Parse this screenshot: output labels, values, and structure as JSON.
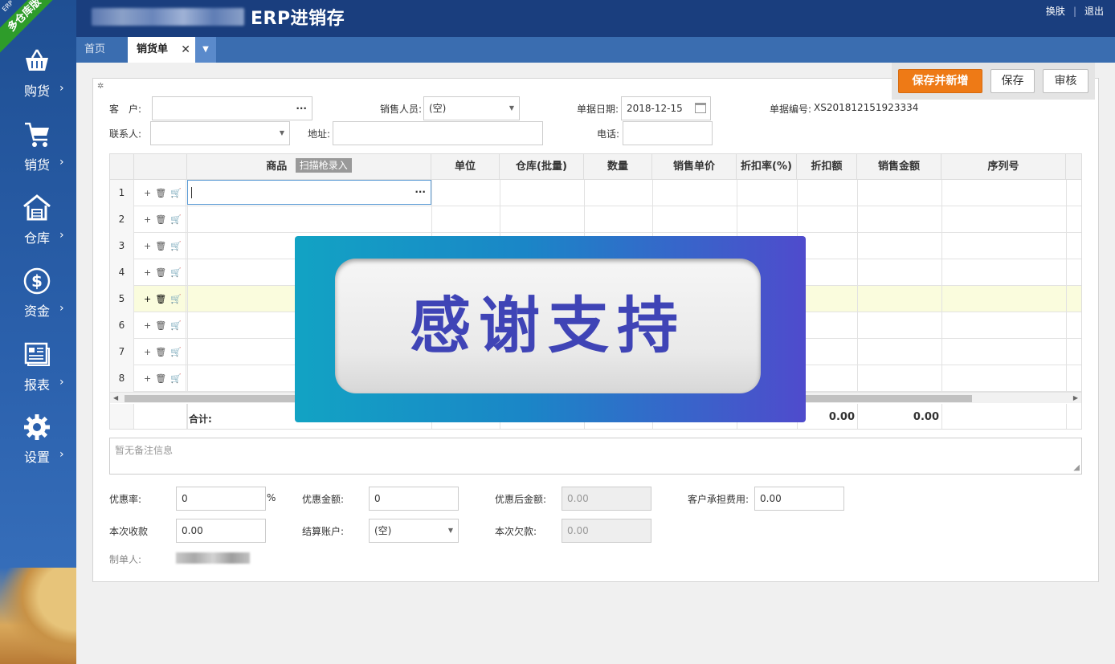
{
  "header": {
    "product_title": "ERP进销存",
    "links": [
      "换肤",
      "退出"
    ]
  },
  "ribbon": {
    "small": "ERP",
    "label": "多仓库版"
  },
  "sidebar": {
    "items": [
      {
        "label": "购货",
        "icon": "basket-icon"
      },
      {
        "label": "销货",
        "icon": "cart-icon"
      },
      {
        "label": "仓库",
        "icon": "warehouse-icon"
      },
      {
        "label": "资金",
        "icon": "dollar-icon"
      },
      {
        "label": "报表",
        "icon": "report-icon"
      },
      {
        "label": "设置",
        "icon": "gear-icon"
      }
    ]
  },
  "tabs": {
    "home": "首页",
    "active": "销货单",
    "close": "✕",
    "more": "▼"
  },
  "actions": {
    "save_new": "保存并新增",
    "save": "保存",
    "audit": "审核"
  },
  "form": {
    "customer_label": "客　户:",
    "customer_value": "",
    "customer_btn": "···",
    "salesperson_label": "销售人员:",
    "salesperson_value": "(空)",
    "date_label": "单据日期:",
    "date_value": "2018-12-15",
    "doc_no_label": "单据编号:",
    "doc_no_value": "XS201812151923334",
    "contact_label": "联系人:",
    "contact_value": "",
    "address_label": "地址:",
    "address_value": "",
    "phone_label": "电话:",
    "phone_value": ""
  },
  "grid": {
    "columns": [
      "商品",
      "单位",
      "仓库(批量)",
      "数量",
      "销售单价",
      "折扣率(%)",
      "折扣额",
      "销售金额",
      "序列号"
    ],
    "scan_button": "扫描枪录入",
    "rows": [
      "1",
      "2",
      "3",
      "4",
      "5",
      "6",
      "7",
      "8"
    ],
    "highlighted_row": "5",
    "ops": [
      "+",
      "🗑",
      "🛒"
    ],
    "cell_button": "···",
    "total_label": "合计:",
    "discount_total": "0.00",
    "amount_total": "0.00"
  },
  "overlay": {
    "text": "感谢支持"
  },
  "remark": {
    "placeholder": "暂无备注信息"
  },
  "footer": {
    "discount_rate_label": "优惠率:",
    "discount_rate_value": "0",
    "percent": "%",
    "discount_amount_label": "优惠金额:",
    "discount_amount_value": "0",
    "after_discount_label": "优惠后金额:",
    "after_discount_value": "0.00",
    "customer_fee_label": "客户承担费用:",
    "customer_fee_value": "0.00",
    "received_label": "本次收款",
    "received_value": "0.00",
    "account_label": "结算账户:",
    "account_value": "(空)",
    "debt_label": "本次欠款:",
    "debt_value": "0.00",
    "maker_label": "制单人:"
  },
  "colors": {
    "header_bg": "#1a3e7e",
    "sidebar_bg": "#2b61ad",
    "primary_button": "#ee7a16",
    "ribbon": "#2e9c2a",
    "highlight_row": "#fafcdd"
  }
}
